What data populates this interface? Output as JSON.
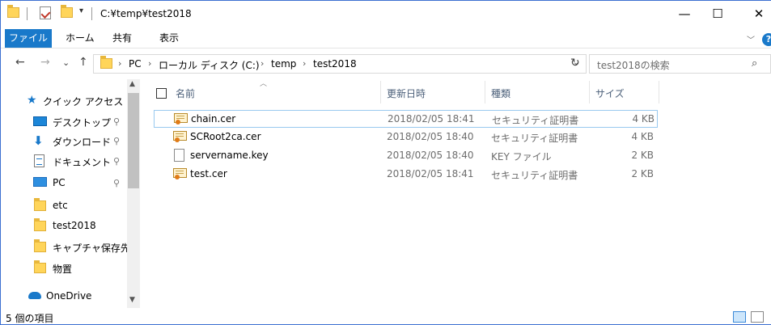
{
  "window": {
    "title": "C:¥temp¥test2018",
    "minimize": "—",
    "maximize": "☐",
    "close": "✕"
  },
  "ribbon": {
    "tabs": [
      "ファイル",
      "ホーム",
      "共有",
      "表示"
    ],
    "collapse": "﹀",
    "help": "?"
  },
  "nav": {
    "back": "←",
    "forward": "→",
    "recent": "⌄",
    "up": "↑",
    "breadcrumb": [
      "PC",
      "ローカル ディスク (C:)",
      "temp",
      "test2018"
    ],
    "separator": "›",
    "dropdown": "⌄",
    "refresh": "↻",
    "search_placeholder": "test2018の検索",
    "search_icon": "⌕"
  },
  "navpane": {
    "items": [
      {
        "label": "クイック アクセス",
        "icon": "star-icon"
      },
      {
        "label": "デスクトップ",
        "icon": "desktop-icon",
        "pinned": true
      },
      {
        "label": "ダウンロード",
        "icon": "download-icon",
        "pinned": true
      },
      {
        "label": "ドキュメント",
        "icon": "documents-icon",
        "pinned": true
      },
      {
        "label": "PC",
        "icon": "pc-icon",
        "pinned": true
      },
      {
        "label": "etc",
        "icon": "folder-icon"
      },
      {
        "label": "test2018",
        "icon": "folder-icon"
      },
      {
        "label": "キャプチャ保存先",
        "icon": "folder-icon"
      },
      {
        "label": "物置",
        "icon": "folder-icon"
      },
      {
        "label": "OneDrive",
        "icon": "onedrive-icon"
      }
    ],
    "pin_glyph": "📌",
    "scroll_up": "▲",
    "scroll_down": "▼"
  },
  "columns": {
    "sort_indicator": "︿",
    "name": "名前",
    "date": "更新日時",
    "type": "種類",
    "size": "サイズ"
  },
  "files": [
    {
      "name": "chain.cer",
      "date": "2018/02/05 18:41",
      "type": "セキュリティ証明書",
      "size": "4 KB",
      "icon": "certificate-icon"
    },
    {
      "name": "SCRoot2ca.cer",
      "date": "2018/02/05 18:40",
      "type": "セキュリティ証明書",
      "size": "4 KB",
      "icon": "certificate-icon"
    },
    {
      "name": "servername.key",
      "date": "2018/02/05 18:40",
      "type": "KEY ファイル",
      "size": "2 KB",
      "icon": "file-icon"
    },
    {
      "name": "test.cer",
      "date": "2018/02/05 18:41",
      "type": "セキュリティ証明書",
      "size": "2 KB",
      "icon": "certificate-icon"
    }
  ],
  "status": {
    "item_count": "5 個の項目"
  },
  "colors": {
    "accent": "#1979ca",
    "folder": "#ffd55a",
    "selection_border": "#99c9ef"
  }
}
